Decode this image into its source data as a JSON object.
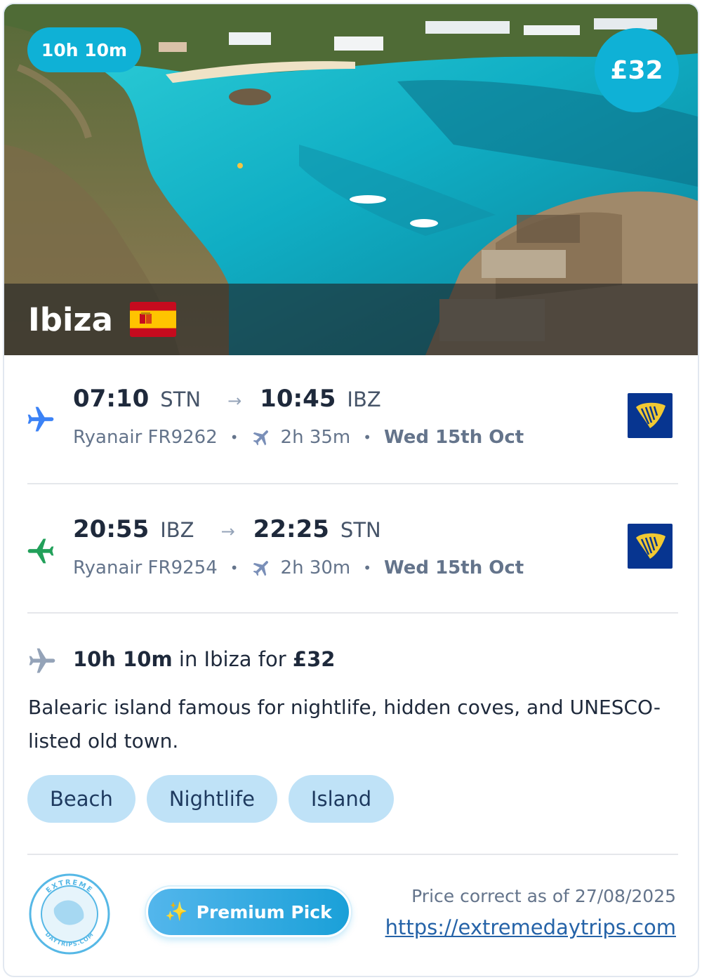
{
  "hero": {
    "duration_pill": "10h 10m",
    "price_badge": "£32",
    "destination": "Ibiza",
    "image_alt": "Ibiza turquoise cove with boats"
  },
  "outbound": {
    "depart_time": "07:10",
    "depart_code": "STN",
    "arrow": "→",
    "arrive_time": "10:45",
    "arrive_code": "IBZ",
    "flight": "Ryanair FR9262",
    "duration": "2h 35m",
    "date": "Wed 15th Oct",
    "icon": "plane-departure-icon",
    "icon_color": "#3b82f6"
  },
  "return": {
    "depart_time": "20:55",
    "depart_code": "IBZ",
    "arrow": "→",
    "arrive_time": "22:25",
    "arrive_code": "STN",
    "flight": "Ryanair FR9254",
    "duration": "2h 30m",
    "date": "Wed 15th Oct",
    "icon": "plane-arrival-icon",
    "icon_color": "#22a05a"
  },
  "summary": {
    "duration": "10h 10m",
    "middle": " in Ibiza for ",
    "price": "£32"
  },
  "description": "Balearic island famous for nightlife, hidden coves, and UNESCO-listed old town.",
  "tags": [
    "Beach",
    "Nightlife",
    "Island"
  ],
  "footer": {
    "logo_text_top": "EXTREME",
    "logo_text_bottom": "DAYTRIPS.COM",
    "premium_label": "Premium Pick",
    "price_note": "Price correct as of 27/08/2025",
    "site_link": "https://extremedaytrips.com"
  },
  "colors": {
    "accent": "#0fb1d6",
    "tag_bg": "#bfe2f7",
    "ryanair_blue": "#073590",
    "ryanair_yellow": "#f1c933"
  }
}
